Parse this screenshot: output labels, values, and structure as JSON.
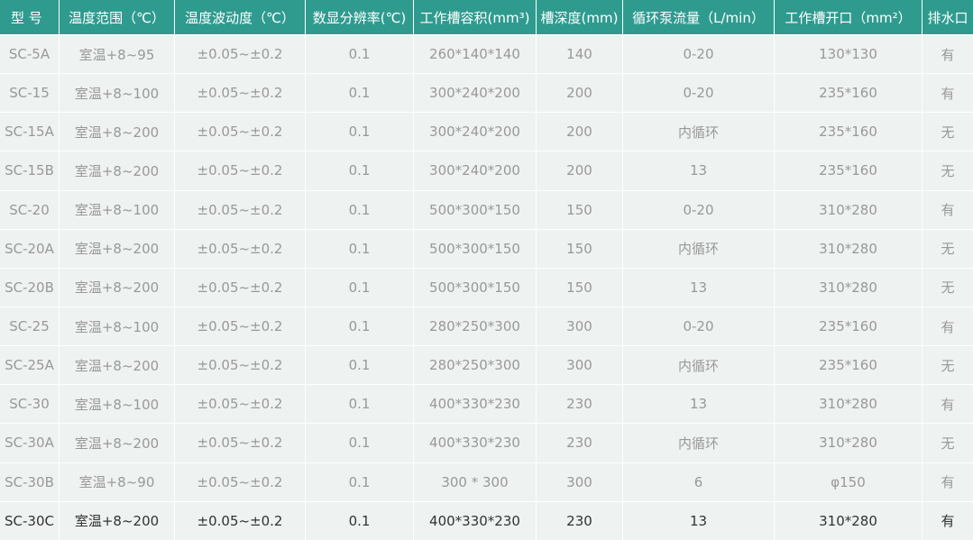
{
  "table": {
    "headers": [
      "型 号",
      "温度范围（℃）",
      "温度波动度（℃）",
      "数显分辨率(℃)",
      "工作槽容积(mm³)",
      "槽深度(mm)",
      "循环泵流量（L/min）",
      "工作槽开口（mm²）",
      "排水口"
    ],
    "rows": [
      [
        "SC-5A",
        "室温+8~95",
        "±0.05~±0.2",
        "0.1",
        "260*140*140",
        "140",
        "0-20",
        "130*130",
        "有"
      ],
      [
        "SC-15",
        "室温+8~100",
        "±0.05~±0.2",
        "0.1",
        "300*240*200",
        "200",
        "0-20",
        "235*160",
        "有"
      ],
      [
        "SC-15A",
        "室温+8~200",
        "±0.05~±0.2",
        "0.1",
        "300*240*200",
        "200",
        "内循环",
        "235*160",
        "无"
      ],
      [
        "SC-15B",
        "室温+8~200",
        "±0.05~±0.2",
        "0.1",
        "300*240*200",
        "200",
        "13",
        "235*160",
        "无"
      ],
      [
        "SC-20",
        "室温+8~100",
        "±0.05~±0.2",
        "0.1",
        "500*300*150",
        "150",
        "0-20",
        "310*280",
        "有"
      ],
      [
        "SC-20A",
        "室温+8~200",
        "±0.05~±0.2",
        "0.1",
        "500*300*150",
        "150",
        "内循环",
        "310*280",
        "无"
      ],
      [
        "SC-20B",
        "室温+8~200",
        "±0.05~±0.2",
        "0.1",
        "500*300*150",
        "150",
        "13",
        "310*280",
        "无"
      ],
      [
        "SC-25",
        "室温+8~100",
        "±0.05~±0.2",
        "0.1",
        "280*250*300",
        "300",
        "0-20",
        "235*160",
        "有"
      ],
      [
        "SC-25A",
        "室温+8~200",
        "±0.05~±0.2",
        "0.1",
        "280*250*300",
        "300",
        "内循环",
        "235*160",
        "无"
      ],
      [
        "SC-30",
        "室温+8~100",
        "±0.05~±0.2",
        "0.1",
        "400*330*230",
        "230",
        "13",
        "310*280",
        "有"
      ],
      [
        "SC-30A",
        "室温+8~200",
        "±0.05~±0.2",
        "0.1",
        "400*330*230",
        "230",
        "内循环",
        "310*280",
        "无"
      ],
      [
        "SC-30B",
        "室温+8~90",
        "±0.05~±0.2",
        "0.1",
        "300 * 300",
        "300",
        "6",
        "φ150",
        "有"
      ],
      [
        "SC-30C",
        "室温+8~200",
        "±0.05~±0.2",
        "0.1",
        "400*330*230",
        "230",
        "13",
        "310*280",
        "有"
      ]
    ]
  },
  "colors": {
    "header_bg": "#2f9b8f",
    "header_text": "#ffffff",
    "cell_bg": "#eef2f1",
    "cell_text": "#999999",
    "last_row_text": "#333333"
  }
}
